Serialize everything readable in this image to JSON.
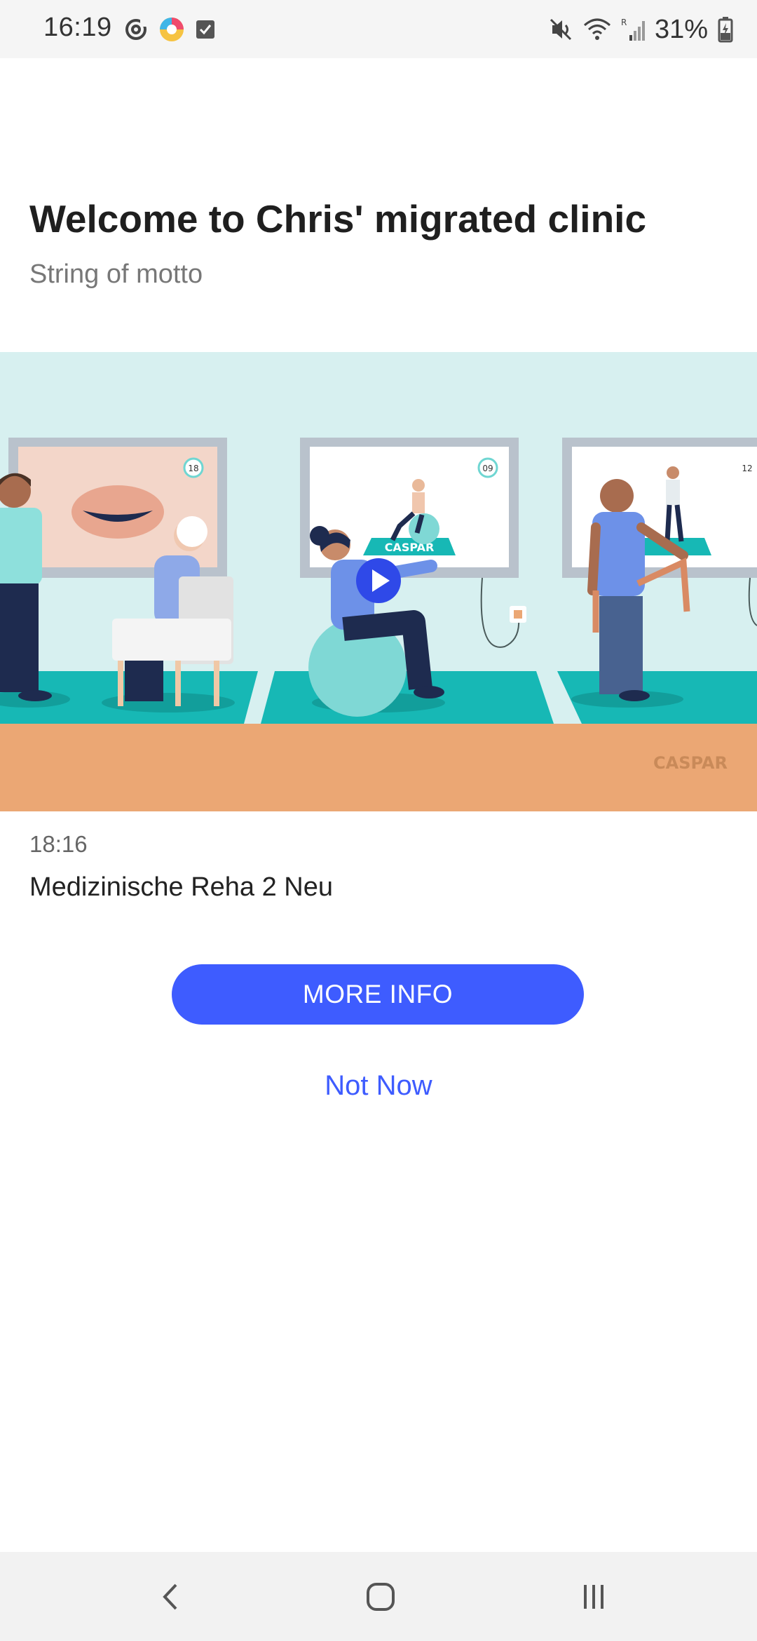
{
  "status_bar": {
    "time": "16:19",
    "battery_percent": "31%",
    "icons": [
      "sync-icon",
      "app-icon",
      "checkbox-icon",
      "mute-icon",
      "wifi-icon",
      "signal-icon",
      "battery-icon"
    ]
  },
  "header": {
    "title": "Welcome to Chris' migrated clinic",
    "motto": "String of motto"
  },
  "hero": {
    "brand_watermark": "CASPAR",
    "screen_numbers": [
      "18",
      "09",
      "12"
    ],
    "screen_brand": "CASPAR"
  },
  "program": {
    "time": "18:16",
    "name": "Medizinische Reha 2 Neu"
  },
  "actions": {
    "more_info_label": "MORE INFO",
    "not_now_label": "Not Now"
  },
  "colors": {
    "accent": "#3e5cff",
    "hero_bg": "#d7f0f0",
    "floor_teal": "#17b8b5",
    "floor_orange": "#eba774"
  },
  "nav": {
    "icons": [
      "back-icon",
      "home-icon",
      "recents-icon"
    ]
  }
}
